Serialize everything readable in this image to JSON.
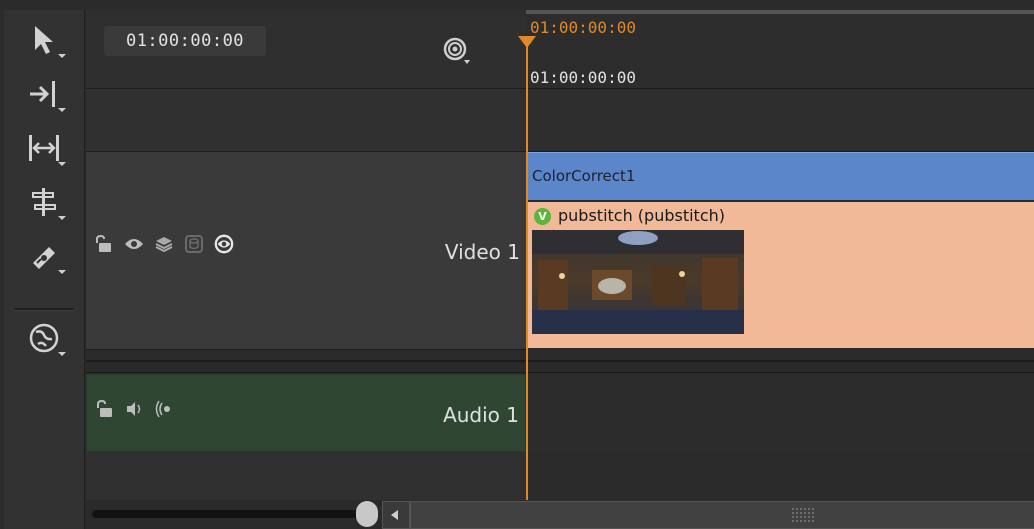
{
  "header": {
    "timecode": "01:00:00:00"
  },
  "ruler": {
    "timecode_top": "01:00:00:00",
    "timecode_bottom": "01:00:00:00"
  },
  "tracks": {
    "video": {
      "label": "Video 1",
      "icons": [
        "lock-icon",
        "eye-icon",
        "layers-icon",
        "disk-icon",
        "blend-icon"
      ]
    },
    "audio": {
      "label": "Audio 1",
      "icons": [
        "lock-icon",
        "speaker-icon",
        "radio-waves-icon"
      ]
    }
  },
  "clips": {
    "effect": {
      "label": "ColorCorrect1",
      "color": "#5b86c9"
    },
    "media": {
      "label": "pubstitch (pubstitch)",
      "badge": "V",
      "color": "#f1b997"
    }
  },
  "tools": [
    "pointer-tool",
    "track-forward-tool",
    "ripple-trim-tool",
    "slip-tool",
    "razor-tool",
    "globe-tool"
  ],
  "colors": {
    "playhead": "#e0892a",
    "audio_header": "#2f4633"
  }
}
